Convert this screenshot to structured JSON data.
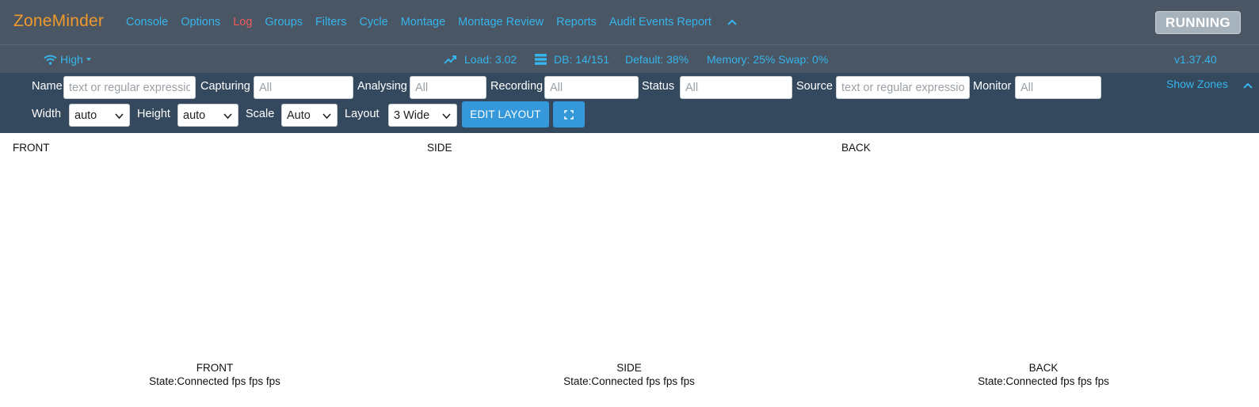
{
  "brand": "ZoneMinder",
  "nav": [
    "Console",
    "Options",
    "Log",
    "Groups",
    "Filters",
    "Cycle",
    "Montage",
    "Montage Review",
    "Reports",
    "Audit Events Report"
  ],
  "nav_active": "Log",
  "state_button": "RUNNING",
  "status": {
    "bandwidth": "High",
    "load": "Load: 3.02",
    "db": "DB: 14/151",
    "default": "Default: 38%",
    "memory": "Memory: 25% Swap: 0%",
    "version": "v1.37.40"
  },
  "filters": {
    "name_label": "Name",
    "name_placeholder": "text or regular expression",
    "capturing_label": "Capturing",
    "capturing_placeholder": "All",
    "analysing_label": "Analysing",
    "analysing_placeholder": "All",
    "recording_label": "Recording",
    "recording_placeholder": "All",
    "status_label": "Status",
    "status_placeholder": "All",
    "source_label": "Source",
    "source_placeholder": "text or regular expression",
    "monitor_label": "Monitor",
    "monitor_placeholder": "All",
    "show_zones": "Show Zones",
    "width_label": "Width",
    "width_value": "auto",
    "height_label": "Height",
    "height_value": "auto",
    "scale_label": "Scale",
    "scale_value": "Auto",
    "layout_label": "Layout",
    "layout_value": "3 Wide",
    "edit_layout": "EDIT LAYOUT"
  },
  "monitors": [
    {
      "name": "FRONT",
      "state": "State:Connected fps fps fps"
    },
    {
      "name": "SIDE",
      "state": "State:Connected fps fps fps"
    },
    {
      "name": "BACK",
      "state": "State:Connected fps fps fps"
    }
  ],
  "colors": {
    "navbar_bg": "#4a5663",
    "filterbar_bg": "#34495e",
    "link": "#36b4ec",
    "brand": "#f19a2c",
    "active_nav": "#ef5b5b",
    "button_blue": "#3498db"
  },
  "icons": [
    "wifi-icon",
    "trending-up-icon",
    "database-icon",
    "chevron-up-icon",
    "fullscreen-icon",
    "chevron-down-icon"
  ]
}
